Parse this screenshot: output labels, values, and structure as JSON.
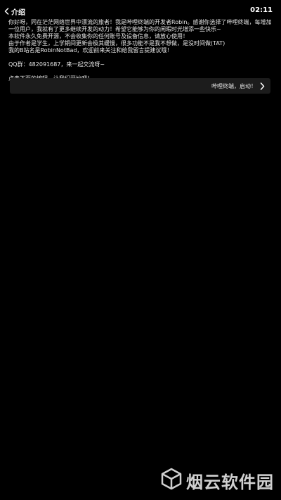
{
  "header": {
    "title": "介绍",
    "time": "02:11",
    "back_icon": "chevron-left-icon"
  },
  "intro": {
    "lines": [
      "你好呀，同在茫茫网络世界中漂流的旅者！我是哔哩终端的开发者Robin。感谢你选择了哔哩终端，每增加一位用户，我就有了更多继续开发的动力！希望它能够为你的闲暇时光增添一些快乐~",
      "本软件永久免费开源，不会收集你的任何账号及设备信息，请放心使用！",
      "由于作者是学生，上学期间更新会极其缓慢，很多功能不是我不想做，是没时间做(TAT)",
      "我的B站名是RobinNotBad，欢迎前来关注和给我留言提建议哦！"
    ],
    "qq": "QQ群：482091687，来一起交流呀~",
    "prompt": "点击下面的按钮，让我们开始吧！"
  },
  "start_button": {
    "label": "哔哩终端，启动！",
    "icon": "chevron-right-icon"
  },
  "watermark": {
    "text": "烟云软件园",
    "icon": "cube-logo-icon"
  }
}
